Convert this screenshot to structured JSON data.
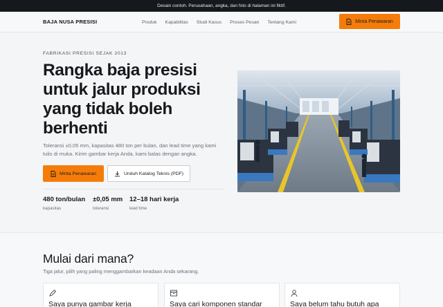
{
  "topbar": {
    "notice": "Desain contoh. Perusahaan, angka, dan foto di halaman ini fiktif."
  },
  "header": {
    "brand": "BAJA NUSA PRESISI",
    "nav": [
      "Produk",
      "Kapabilitas",
      "Studi Kasus",
      "Proses Pesan",
      "Tentang Kami"
    ],
    "cta_label": "Minta Penawaran",
    "cta_icon": "document-icon"
  },
  "hero": {
    "eyebrow": "FABRIKASI PRESISI SEJAK 2013",
    "title": "Rangka baja presisi untuk jalur produksi yang tidak boleh berhenti",
    "subtitle": "Toleransi ±0,05 mm, kapasitas 480 ton per bulan, dan lead time yang kami tulis di muka. Kirim gambar kerja Anda, kami balas dengan angka.",
    "primary_label": "Minta Penawaran",
    "secondary_label": "Unduh Katalog Teknis (PDF)",
    "stats": [
      {
        "value": "480 ton/bulan",
        "label": "kapasitas"
      },
      {
        "value": "±0,05 mm",
        "label": "toleransi"
      },
      {
        "value": "12–18 hari kerja",
        "label": "lead time"
      }
    ],
    "image": "factory-floor-photo"
  },
  "paths": {
    "title": "Mulai dari mana?",
    "subtitle": "Tiga jalur, pilih yang paling menggambarkan keadaan Anda sekarang.",
    "cards": [
      {
        "title": "Saya punya gambar kerja",
        "icon": "pencil-icon"
      },
      {
        "title": "Saya cari komponen standar",
        "icon": "box-icon"
      },
      {
        "title": "Saya belum tahu butuh apa",
        "icon": "person-icon"
      }
    ]
  },
  "colors": {
    "accent": "#f57c0a",
    "dark": "#15181c"
  }
}
